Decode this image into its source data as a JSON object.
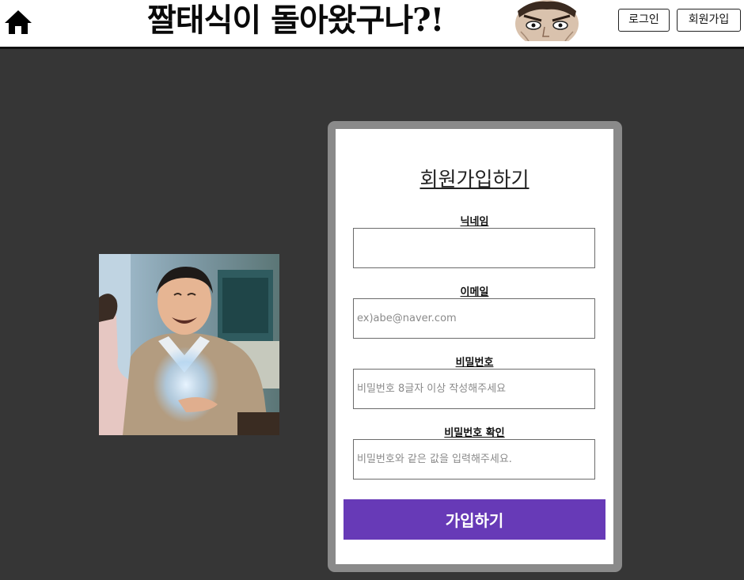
{
  "header": {
    "site_title": "짤태식이 돌아왔구나?!",
    "login_label": "로그인",
    "signup_label": "회원가입",
    "home_icon": "home-icon"
  },
  "form": {
    "title": "회원가입하기",
    "nickname": {
      "label": "닉네임",
      "value": "",
      "placeholder": ""
    },
    "email": {
      "label": "이메일",
      "value": "",
      "placeholder": "ex)abe@naver.com"
    },
    "password": {
      "label": "비밀번호",
      "value": "",
      "placeholder": "비밀번호 8글자 이상 작성해주세요"
    },
    "password_confirm": {
      "label": "비밀번호 확인",
      "value": "",
      "placeholder": "비밀번호와 같은 값을 입력해주세요."
    },
    "submit_label": "가입하기"
  },
  "colors": {
    "background": "#363636",
    "accent": "#673ab7",
    "card_frame": "#8a8a8a"
  }
}
